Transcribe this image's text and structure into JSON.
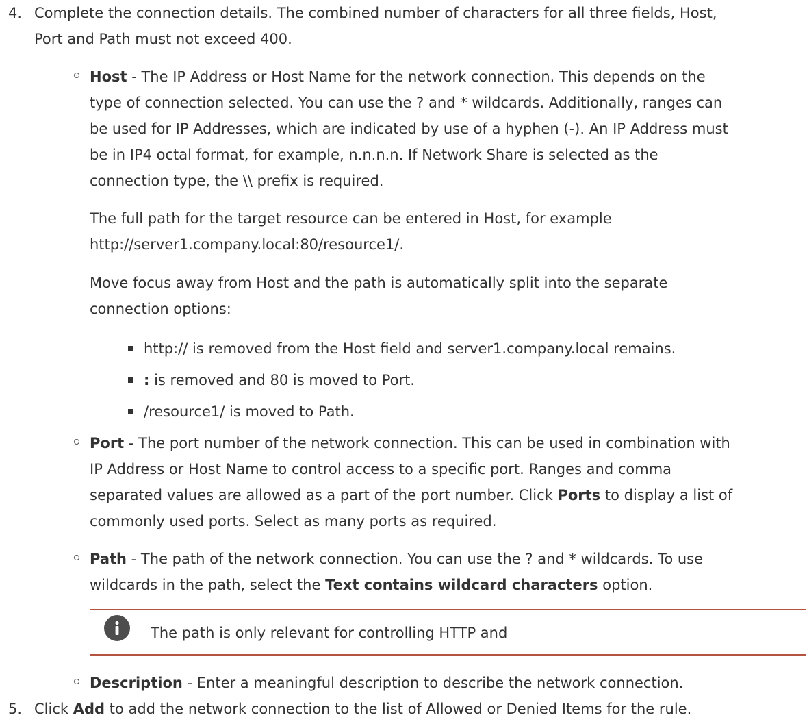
{
  "step4": {
    "number": "4.",
    "line1": "Complete the connection details. The combined number of characters for all three fields, Host,",
    "line2": "Port and Path must not exceed 400."
  },
  "host": {
    "term": "Host",
    "line1_rest": " - The IP Address or Host Name for the network connection. This depends on the",
    "line2": "type of connection selected. You can use the ? and * wildcards. Additionally, ranges can",
    "line3": "be used for IP Addresses, which are indicated by use of a hyphen (-). An IP Address must",
    "line4": "be in IP4 octal format, for example, n.n.n.n. If Network Share is selected as the",
    "line5": "connection type, the \\\\ prefix is required.",
    "para2_line1": "The full path for the target resource can be entered in Host, for example",
    "para2_line2": "http://server1.company.local:80/resource1/.",
    "para3_line1": "Move focus away from Host and the path is automatically split into the separate",
    "para3_line2": "connection options:",
    "bullets": {
      "b1": "http:// is removed from the Host field and server1.company.local remains.",
      "b2_bold": ":",
      "b2_rest": " is removed and 80 is moved to Port.",
      "b3": "/resource1/ is moved to Path."
    }
  },
  "port": {
    "term": "Port",
    "line1_rest": " - The port number of the network connection. This can be used in combination with",
    "line2": "IP Address or Host Name to control access to a specific port. Ranges and comma",
    "line3_a": "separated values are allowed as a part of the port number. Click ",
    "line3_bold": "Ports",
    "line3_b": " to display a list of",
    "line4": "commonly used ports. Select as many ports as required."
  },
  "path": {
    "term": "Path",
    "line1_rest": " - The path of the network connection. You can use the ? and * wildcards. To use",
    "line2_a": "wildcards in the path, select the ",
    "line2_bold": "Text contains wildcard characters",
    "line2_b": " option."
  },
  "note": {
    "icon": "info-icon",
    "text": "The path is only relevant for controlling HTTP and"
  },
  "description": {
    "term": "Description",
    "rest": " - Enter a meaningful description to describe the network connection."
  },
  "step5": {
    "number": "5.",
    "text_a": "Click ",
    "text_bold": "Add",
    "text_b": " to add the network connection to the list of Allowed or Denied Items for the rule."
  },
  "colors": {
    "text": "#333333",
    "note_rule": "#b4533f",
    "icon_bg": "#4d4d4d"
  }
}
